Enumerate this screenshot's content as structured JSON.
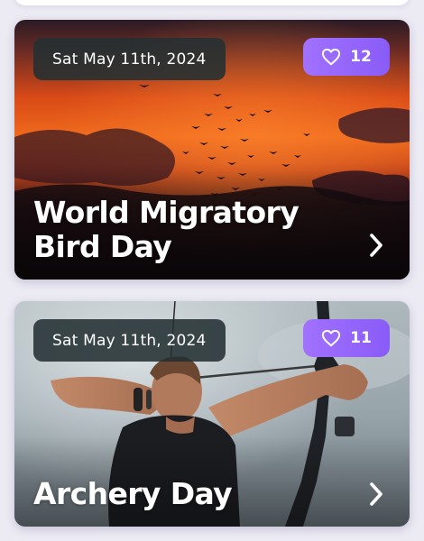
{
  "events": [
    {
      "date": "Sat May 11th, 2024",
      "likes": "12",
      "title": "World Migratory Bird Day",
      "image_icon": "sunset-birds-photo"
    },
    {
      "date": "Sat May 11th, 2024",
      "likes": "11",
      "title": "Archery Day",
      "image_icon": "archer-photo"
    }
  ],
  "colors": {
    "date_pill_bg": "#233032",
    "like_pill_bg": "#9266fb",
    "page_bg": "#ecebf3"
  }
}
